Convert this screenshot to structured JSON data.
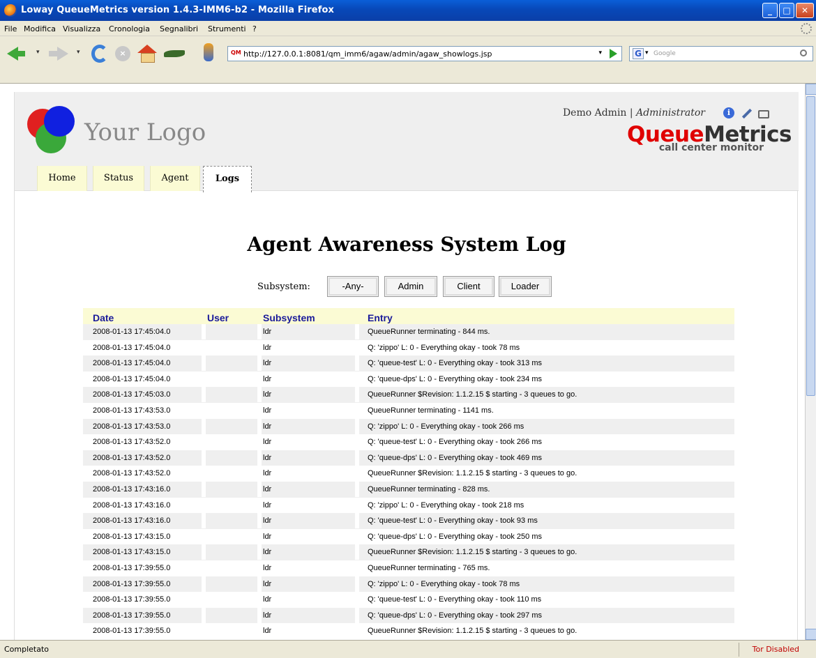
{
  "window": {
    "title": "Loway QueueMetrics version 1.4.3-IMM6-b2 - Mozilla Firefox"
  },
  "menu": [
    "File",
    "Modifica",
    "Visualizza",
    "Cronologia",
    "Segnalibri",
    "Strumenti",
    "?"
  ],
  "nav": {
    "url": "http://127.0.0.1:8081/qm_imm6/agaw/admin/agaw_showlogs.jsp",
    "url_favicon": "QM",
    "search_placeholder": "Google"
  },
  "header": {
    "logo_text": "Your Logo",
    "user": "Demo Admin",
    "role": "Administrator",
    "brand_queue": "Queue",
    "brand_metrics": "Metrics",
    "brand_tagline": "call center monitor"
  },
  "tabs": [
    {
      "label": "Home"
    },
    {
      "label": "Status"
    },
    {
      "label": "Agent"
    },
    {
      "label": "Logs",
      "active": true
    }
  ],
  "page": {
    "title": "Agent Awareness System Log",
    "subsystem_label": "Subsystem:",
    "subsystem_buttons": [
      "-Any-",
      "Admin",
      "Client",
      "Loader"
    ]
  },
  "log": {
    "columns": [
      "Date",
      "User",
      "Subsystem",
      "Entry"
    ],
    "rows": [
      [
        "2008-01-13 17:45:04.0",
        "",
        "ldr",
        "QueueRunner terminating - 844 ms."
      ],
      [
        "2008-01-13 17:45:04.0",
        "",
        "ldr",
        "Q: 'zippo' L: 0 - Everything okay - took 78 ms"
      ],
      [
        "2008-01-13 17:45:04.0",
        "",
        "ldr",
        "Q: 'queue-test' L: 0 - Everything okay - took 313 ms"
      ],
      [
        "2008-01-13 17:45:04.0",
        "",
        "ldr",
        "Q: 'queue-dps' L: 0 - Everything okay - took 234 ms"
      ],
      [
        "2008-01-13 17:45:03.0",
        "",
        "ldr",
        "QueueRunner $Revision: 1.1.2.15 $ starting - 3 queues to go."
      ],
      [
        "2008-01-13 17:43:53.0",
        "",
        "ldr",
        "QueueRunner terminating - 1141 ms."
      ],
      [
        "2008-01-13 17:43:53.0",
        "",
        "ldr",
        "Q: 'zippo' L: 0 - Everything okay - took 266 ms"
      ],
      [
        "2008-01-13 17:43:52.0",
        "",
        "ldr",
        "Q: 'queue-test' L: 0 - Everything okay - took 266 ms"
      ],
      [
        "2008-01-13 17:43:52.0",
        "",
        "ldr",
        "Q: 'queue-dps' L: 0 - Everything okay - took 469 ms"
      ],
      [
        "2008-01-13 17:43:52.0",
        "",
        "ldr",
        "QueueRunner $Revision: 1.1.2.15 $ starting - 3 queues to go."
      ],
      [
        "2008-01-13 17:43:16.0",
        "",
        "ldr",
        "QueueRunner terminating - 828 ms."
      ],
      [
        "2008-01-13 17:43:16.0",
        "",
        "ldr",
        "Q: 'zippo' L: 0 - Everything okay - took 218 ms"
      ],
      [
        "2008-01-13 17:43:16.0",
        "",
        "ldr",
        "Q: 'queue-test' L: 0 - Everything okay - took 93 ms"
      ],
      [
        "2008-01-13 17:43:15.0",
        "",
        "ldr",
        "Q: 'queue-dps' L: 0 - Everything okay - took 250 ms"
      ],
      [
        "2008-01-13 17:43:15.0",
        "",
        "ldr",
        "QueueRunner $Revision: 1.1.2.15 $ starting - 3 queues to go."
      ],
      [
        "2008-01-13 17:39:55.0",
        "",
        "ldr",
        "QueueRunner terminating - 765 ms."
      ],
      [
        "2008-01-13 17:39:55.0",
        "",
        "ldr",
        "Q: 'zippo' L: 0 - Everything okay - took 78 ms"
      ],
      [
        "2008-01-13 17:39:55.0",
        "",
        "ldr",
        "Q: 'queue-test' L: 0 - Everything okay - took 110 ms"
      ],
      [
        "2008-01-13 17:39:55.0",
        "",
        "ldr",
        "Q: 'queue-dps' L: 0 - Everything okay - took 297 ms"
      ],
      [
        "2008-01-13 17:39:55.0",
        "",
        "ldr",
        "QueueRunner $Revision: 1.1.2.15 $ starting - 3 queues to go."
      ]
    ]
  },
  "status": {
    "left": "Completato",
    "right": "Tor Disabled"
  }
}
